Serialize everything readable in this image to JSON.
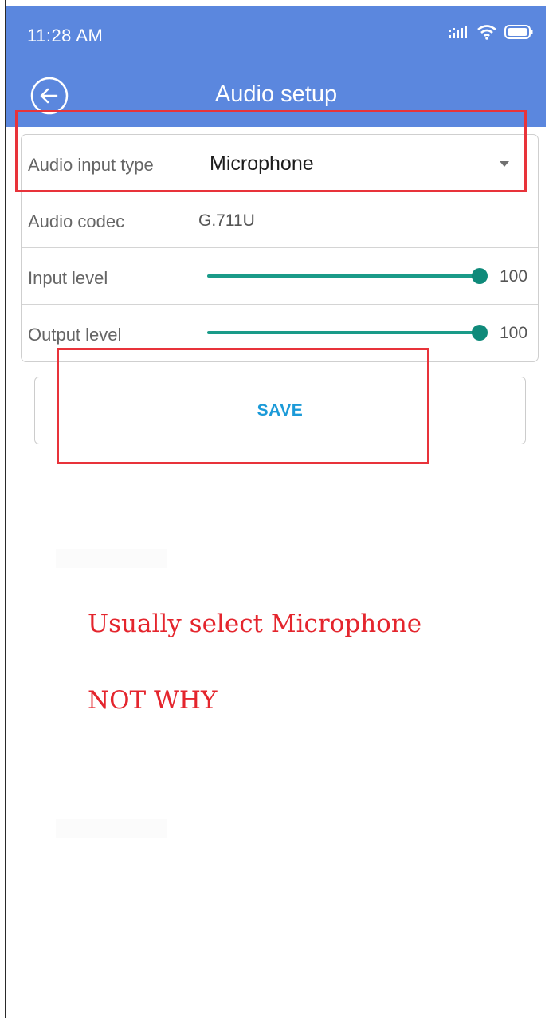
{
  "status_bar": {
    "time": "11:28 AM",
    "icons": [
      "signal-icon",
      "wifi-icon",
      "battery-icon"
    ]
  },
  "header": {
    "title": "Audio setup",
    "back_icon": "back-arrow-icon"
  },
  "form": {
    "audio_input_type": {
      "label": "Audio input type",
      "value": "Microphone",
      "icon": "dropdown-arrow-icon"
    },
    "audio_codec": {
      "label": "Audio codec",
      "value": "G.711U"
    },
    "input_level": {
      "label": "Input level",
      "value": "100",
      "fraction": 1.0
    },
    "output_level": {
      "label": "Output level",
      "value": "100",
      "fraction": 1.0
    }
  },
  "save_button": {
    "label": "SAVE"
  },
  "annotations": {
    "line1": "Usually select Microphone",
    "line2": "NOT WHY"
  },
  "colors": {
    "app_bar": "#5b87de",
    "accent_slider": "#0f8a7a",
    "save_text": "#1b9ad8",
    "highlight_box": "#e8333a",
    "annotation_text": "#e4252d"
  }
}
